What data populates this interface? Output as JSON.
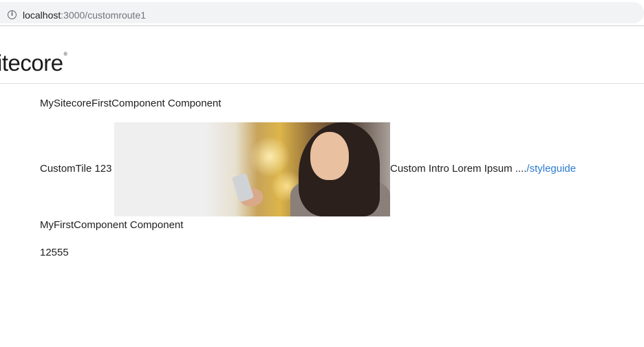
{
  "browser": {
    "url_host": "localhost",
    "url_path": ":3000/customroute1",
    "info_icon": "info-icon"
  },
  "header": {
    "logo_text": "itecore",
    "logo_mark": "®"
  },
  "main": {
    "component1_title": "MySitecoreFirstComponent Component",
    "tile_label": "CustomTile 123",
    "tile_image": "woman-with-phone-image",
    "tile_intro": "Custom Intro Lorem Ipsum ....",
    "tile_link": "/styleguide",
    "component2_title": "MyFirstComponent Component",
    "number_value": "12555"
  },
  "colors": {
    "link": "#2b7bd0",
    "text": "#202020"
  }
}
